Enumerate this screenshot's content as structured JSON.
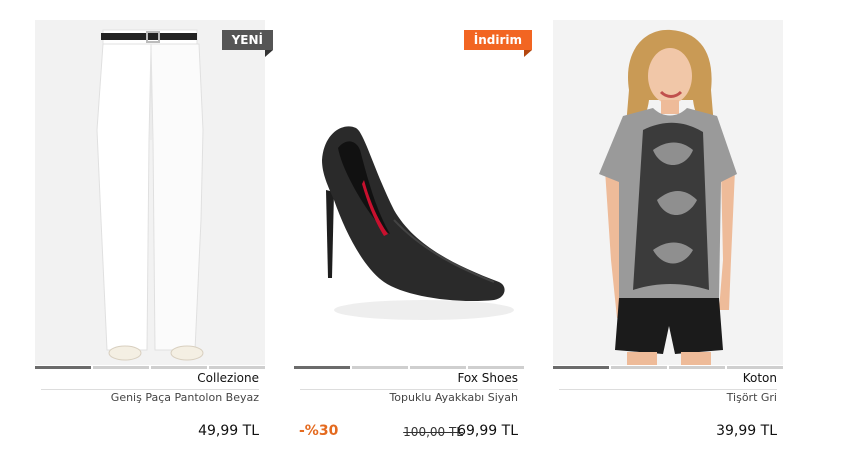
{
  "products": [
    {
      "badge": "YENİ",
      "brand": "Collezione",
      "name": "Geniş Paça Pantolon Beyaz",
      "price": "49,99 TL",
      "image_icon": "white-flared-pants-image",
      "carousel_active": 1,
      "carousel_count": 4
    },
    {
      "badge": "İndirim",
      "brand": "Fox Shoes",
      "name": "Topuklu Ayakkabı Siyah",
      "discount": "-%30",
      "old_price": "100,00 TL",
      "price": "69,99 TL",
      "image_icon": "black-stiletto-image",
      "carousel_active": 1,
      "carousel_count": 4
    },
    {
      "brand": "Koton",
      "name": "Tişört Gri",
      "price": "39,99 TL",
      "image_icon": "grey-tshirt-model-image",
      "carousel_active": 1,
      "carousel_count": 4
    }
  ],
  "colors": {
    "new_badge": "#555555",
    "sale_badge": "#f26522",
    "discount_text": "#e46a1f"
  }
}
